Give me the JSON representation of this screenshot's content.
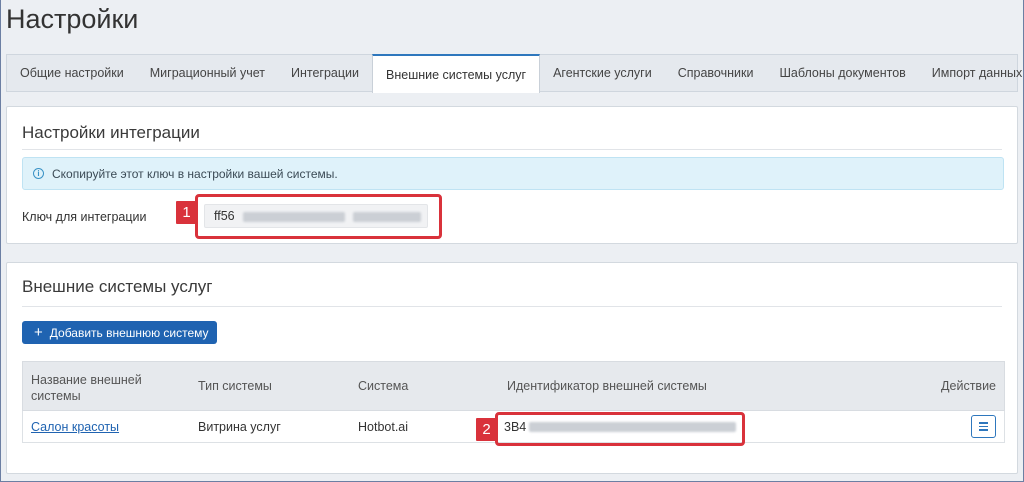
{
  "page": {
    "title": "Настройки"
  },
  "tabs": [
    {
      "label": "Общие настройки"
    },
    {
      "label": "Миграционный учет"
    },
    {
      "label": "Интеграции"
    },
    {
      "label": "Внешние системы услуг",
      "active": true
    },
    {
      "label": "Агентские услуги"
    },
    {
      "label": "Справочники"
    },
    {
      "label": "Шаблоны документов"
    },
    {
      "label": "Импорт данных"
    }
  ],
  "integration": {
    "title": "Настройки интеграции",
    "info_text": "Скопируйте этот ключ в настройки вашей системы.",
    "key_label": "Ключ для интеграции",
    "key_value": "ff56",
    "annotation": "1"
  },
  "external": {
    "title": "Внешние системы услуг",
    "add_button": "Добавить внешнюю систему",
    "columns": {
      "name": "Название внешней системы",
      "type": "Тип системы",
      "system": "Система",
      "identifier": "Идентификатор внешней системы",
      "action": "Действие"
    },
    "rows": [
      {
        "name": "Салон красоты",
        "type": "Витрина услуг",
        "system": "Hotbot.ai",
        "identifier": "3B4"
      }
    ],
    "annotation": "2"
  },
  "colors": {
    "accent": "#1f63b1",
    "annotation": "#d9323b",
    "info_bg": "#dff2fa"
  }
}
